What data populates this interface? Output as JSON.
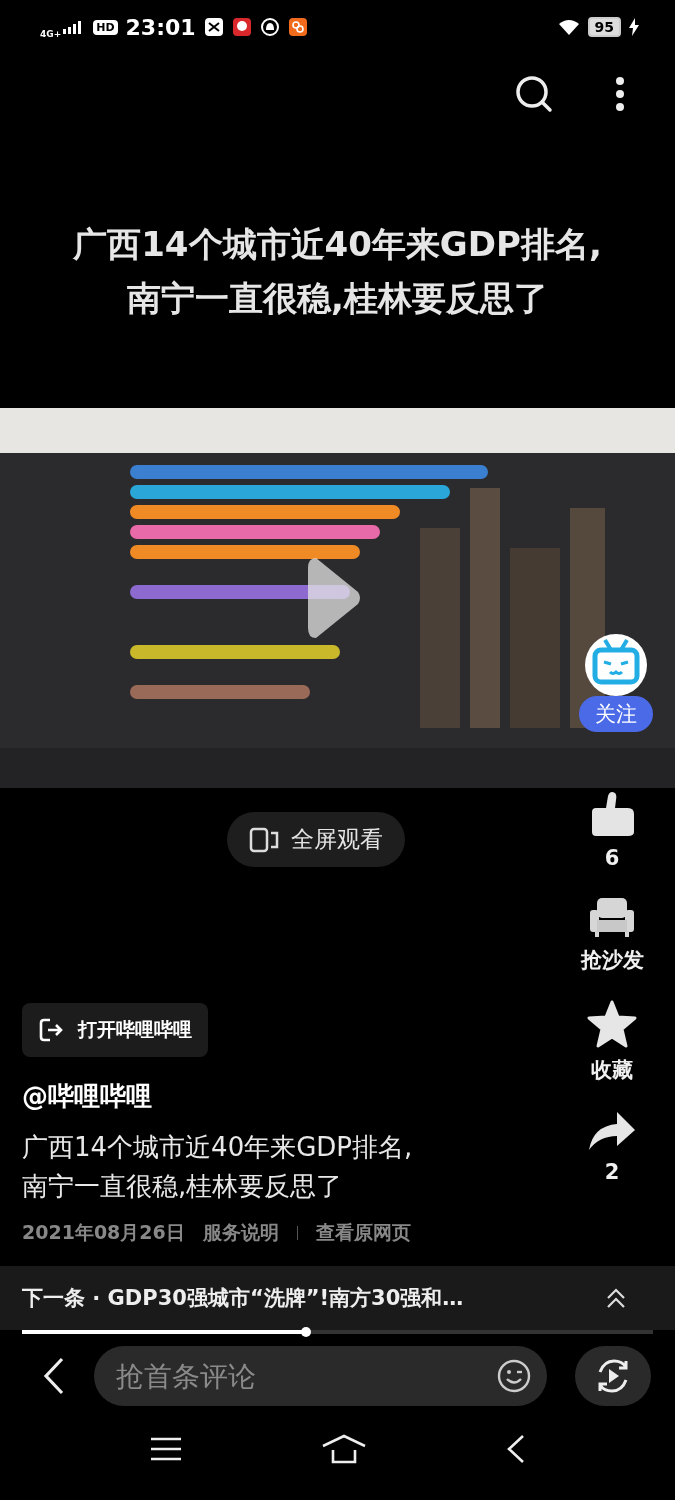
{
  "status_bar": {
    "network": "4G+",
    "hd": "HD",
    "time": "23:01",
    "battery": "95"
  },
  "headline": "广西14个城市近40年来GDP排名,\n南宁一直很稳,桂林要反思了",
  "video": {
    "kind": "picture",
    "follow_button": "关注"
  },
  "fullscreen_button": "全屏观看",
  "actions": [
    {
      "kind": "like",
      "label": "6"
    },
    {
      "kind": "sofa",
      "label": "抢沙发"
    },
    {
      "kind": "star",
      "label": "收藏"
    },
    {
      "kind": "share",
      "label": "2"
    }
  ],
  "open_app_button": "打开哔哩哔哩",
  "author": "@哔哩哔哩",
  "caption": "广西14个城市近40年来GDP排名,\n南宁一直很稳,桂林要反思了",
  "meta": {
    "date": "2021年08月26日",
    "service_link": "服务说明",
    "source_link": "查看原网页"
  },
  "next_item": {
    "text": "下一条 · GDP30强城市“洗牌”!南方30强和…"
  },
  "progress": {
    "level": 0.45
  },
  "comment_field": {
    "placeholder": "抢首条评论"
  }
}
